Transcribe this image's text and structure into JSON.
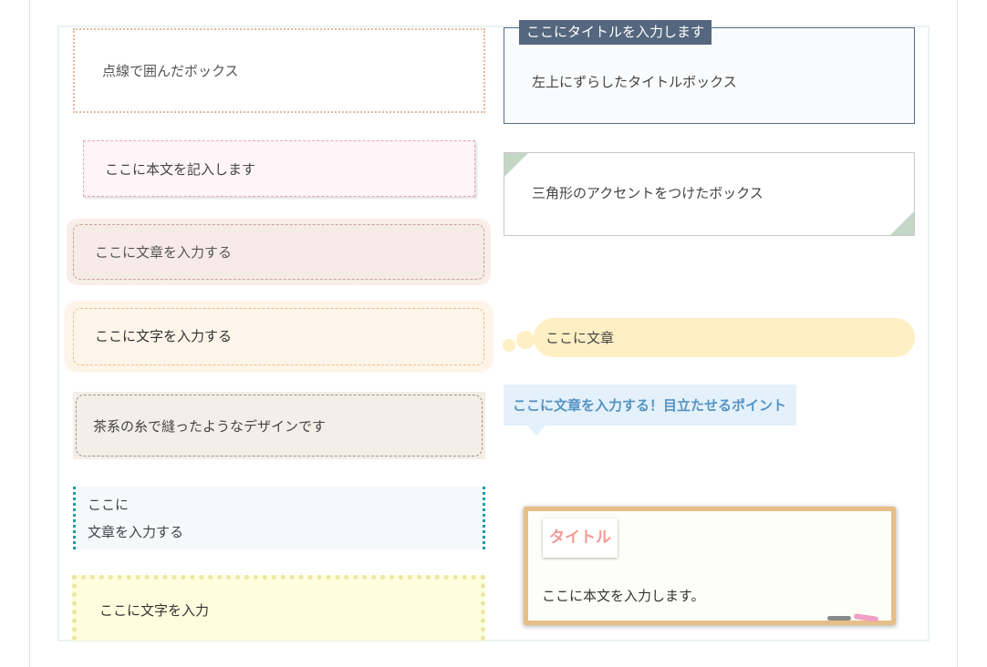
{
  "left": {
    "dotted_box": "点線で囲んだボックス",
    "memo_box": "ここに本文を記入します",
    "pink_stitch_box": "ここに文章を入力する",
    "orange_stitch_box": "ここに文字を入力する",
    "brown_thread_box": "茶系の糸で縫ったようなデザインです",
    "side_dotted_box": {
      "line1": "ここに",
      "line2": "文章を入力する"
    },
    "yellow_dotted_box": "ここに文字を入力"
  },
  "right": {
    "offset_title_box": {
      "title": "ここにタイトルを入力します",
      "body": "左上にずらしたタイトルボックス"
    },
    "triangle_box": "三角形のアクセントをつけたボックス",
    "thought_bubble": "ここに文章",
    "point_balloon": "ここに文章を入力する！目立たせるポイント",
    "chalkboard": {
      "title": "タイトル",
      "body": "ここに本文を入力します。"
    }
  },
  "colors": {
    "title_tab": "#55677f",
    "triangle_accent": "#c4d7c7",
    "bubble": "#ffefc4",
    "point_balloon": "#e4f1fb",
    "point_text": "#5593c3",
    "board_frame": "#e5be88",
    "board_title": "#f29b94"
  }
}
